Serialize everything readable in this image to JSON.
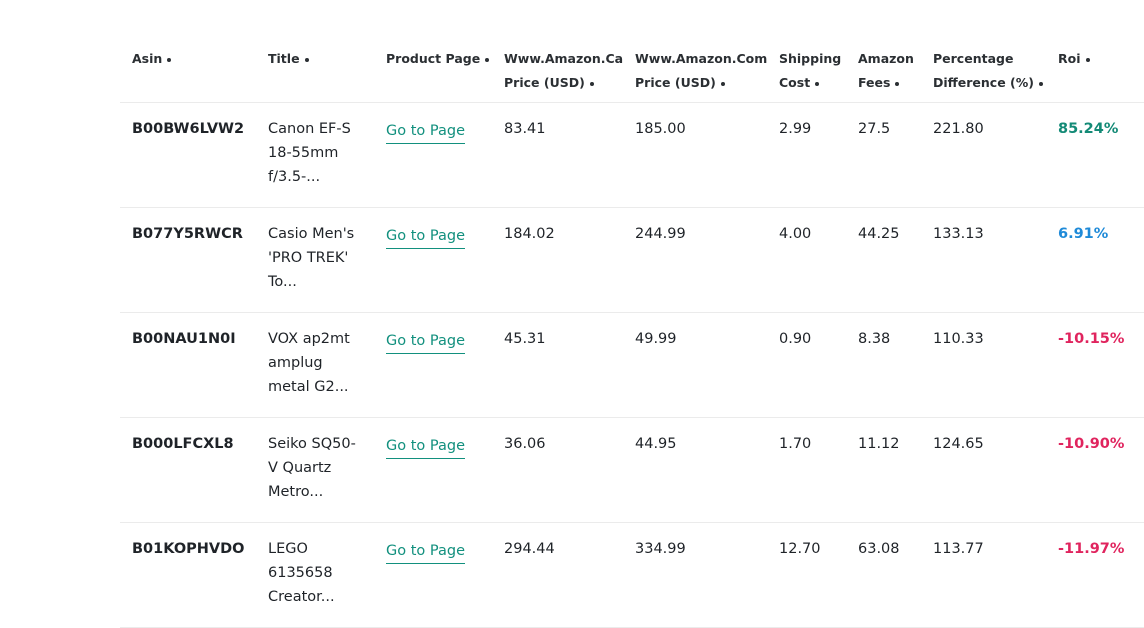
{
  "columns": [
    {
      "line1": "Asin",
      "line2": ""
    },
    {
      "line1": "Title",
      "line2": ""
    },
    {
      "line1": "Product Page",
      "line2": ""
    },
    {
      "line1": "Www.Amazon.Ca",
      "line2": "Price (USD)"
    },
    {
      "line1": "Www.Amazon.Com",
      "line2": "Price (USD)"
    },
    {
      "line1": "Shipping",
      "line2": "Cost"
    },
    {
      "line1": "Amazon",
      "line2": "Fees"
    },
    {
      "line1": "Percentage",
      "line2": "Difference (%)"
    },
    {
      "line1": "Roi",
      "line2": ""
    }
  ],
  "rows": [
    {
      "asin": "B00BW6LVW2",
      "title": [
        "Canon EF-S",
        "18-55mm",
        "f/3.5-..."
      ],
      "link": "Go to Page",
      "ca_price": "83.41",
      "com_price": "185.00",
      "shipping": "2.99",
      "fees": "27.5",
      "pct_diff": "221.80",
      "roi": "85.24%",
      "roi_color": "green"
    },
    {
      "asin": "B077Y5RWCR",
      "title": [
        "Casio Men's",
        "'PRO TREK'",
        "To..."
      ],
      "link": "Go to Page",
      "ca_price": "184.02",
      "com_price": "244.99",
      "shipping": "4.00",
      "fees": "44.25",
      "pct_diff": "133.13",
      "roi": "6.91%",
      "roi_color": "blue"
    },
    {
      "asin": "B00NAU1N0I",
      "title": [
        "VOX ap2mt",
        "amplug",
        "metal G2..."
      ],
      "link": "Go to Page",
      "ca_price": "45.31",
      "com_price": "49.99",
      "shipping": "0.90",
      "fees": "8.38",
      "pct_diff": "110.33",
      "roi": "-10.15%",
      "roi_color": "red"
    },
    {
      "asin": "B000LFCXL8",
      "title": [
        "Seiko SQ50-",
        "V Quartz",
        "Metro..."
      ],
      "link": "Go to Page",
      "ca_price": "36.06",
      "com_price": "44.95",
      "shipping": "1.70",
      "fees": "11.12",
      "pct_diff": "124.65",
      "roi": "-10.90%",
      "roi_color": "red"
    },
    {
      "asin": "B01KOPHVDO",
      "title": [
        "LEGO",
        "6135658",
        "Creator..."
      ],
      "link": "Go to Page",
      "ca_price": "294.44",
      "com_price": "334.99",
      "shipping": "12.70",
      "fees": "63.08",
      "pct_diff": "113.77",
      "roi": "-11.97%",
      "roi_color": "red"
    }
  ],
  "colors": {
    "link": "#12907e",
    "roi_green": "#138a76",
    "roi_blue": "#1e8ad8",
    "roi_red": "#e0245e"
  }
}
